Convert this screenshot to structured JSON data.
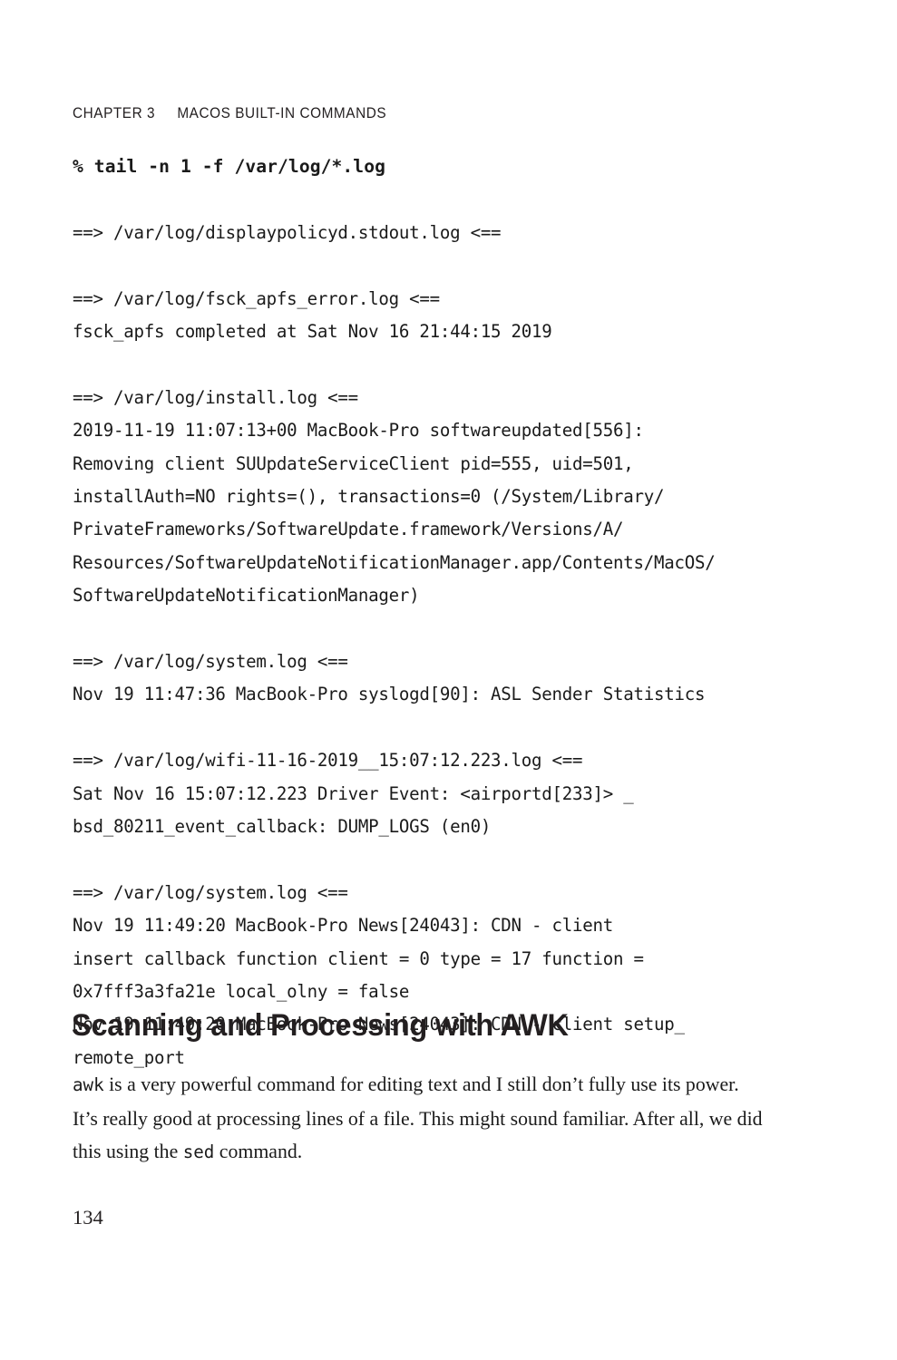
{
  "page": {
    "folio": "134",
    "background_color": "#ffffff",
    "text_color": "#1a1a1a"
  },
  "running_head": {
    "chapter_label": "CHAPTER 3",
    "chapter_title": "MACOS BUILT-IN COMMANDS"
  },
  "code_block": {
    "command": "% tail -n 1 -f /var/log/*.log",
    "lines": [
      "==> /var/log/displaypolicyd.stdout.log <==",
      "",
      "==> /var/log/fsck_apfs_error.log <==",
      "fsck_apfs completed at Sat Nov 16 21:44:15 2019",
      "",
      "==> /var/log/install.log <==",
      "2019-11-19 11:07:13+00 MacBook-Pro softwareupdated[556]:",
      "Removing client SUUpdateServiceClient pid=555, uid=501,",
      "installAuth=NO rights=(), transactions=0 (/System/Library/",
      "PrivateFrameworks/SoftwareUpdate.framework/Versions/A/",
      "Resources/SoftwareUpdateNotificationManager.app/Contents/MacOS/",
      "SoftwareUpdateNotificationManager)",
      "",
      "==> /var/log/system.log <==",
      "Nov 19 11:47:36 MacBook-Pro syslogd[90]: ASL Sender Statistics",
      "",
      "==> /var/log/wifi-11-16-2019__15:07:12.223.log <==",
      "Sat Nov 16 15:07:12.223 Driver Event: <airportd[233]> _",
      "bsd_80211_event_callback: DUMP_LOGS (en0)",
      "",
      "==> /var/log/system.log <==",
      "Nov 19 11:49:20 MacBook-Pro News[24043]: CDN - client",
      "insert callback function client = 0 type = 17 function =",
      "0x7fff3a3fa21e local_olny = false",
      "Nov 19 11:49:20 MacBook-Pro News[24043]: CDN - client setup_",
      "remote_port"
    ]
  },
  "section": {
    "heading": "Scanning and Processing with AWK",
    "paragraph": {
      "part1": "awk",
      "part2": " is a very powerful command for editing text and I still don’t fully use its power. It’s really good at processing lines of a file. This might sound familiar. After all, we did this using the ",
      "part3": "sed",
      "part4": " command."
    }
  }
}
